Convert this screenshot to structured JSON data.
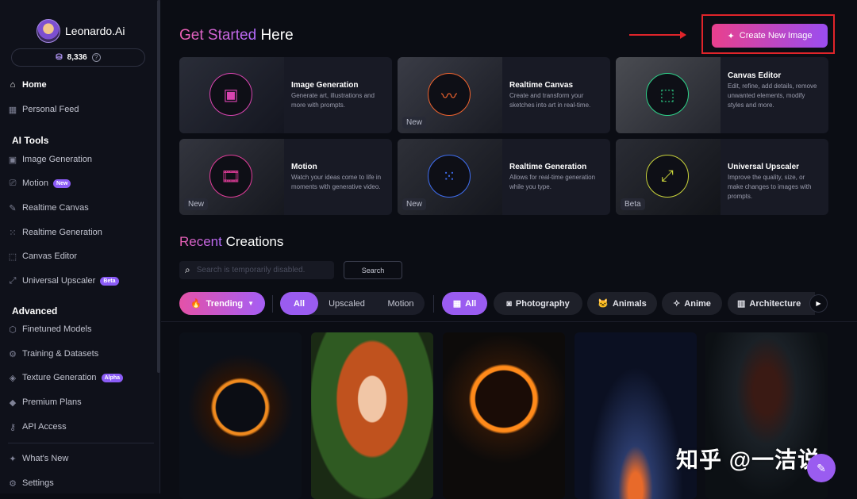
{
  "app": {
    "name": "Leonardo.Ai",
    "credits": "8,336"
  },
  "sidebar": {
    "home": "Home",
    "personal_feed": "Personal Feed",
    "ai_tools_heading": "AI Tools",
    "tools": [
      {
        "label": "Image Generation",
        "badge": ""
      },
      {
        "label": "Motion",
        "badge": "New"
      },
      {
        "label": "Realtime Canvas",
        "badge": ""
      },
      {
        "label": "Realtime Generation",
        "badge": ""
      },
      {
        "label": "Canvas Editor",
        "badge": ""
      },
      {
        "label": "Universal Upscaler",
        "badge": "Beta"
      }
    ],
    "advanced_heading": "Advanced",
    "advanced": [
      {
        "label": "Finetuned Models",
        "badge": ""
      },
      {
        "label": "Training & Datasets",
        "badge": ""
      },
      {
        "label": "Texture Generation",
        "badge": "Alpha"
      },
      {
        "label": "Premium Plans",
        "badge": ""
      },
      {
        "label": "API Access",
        "badge": ""
      }
    ],
    "whats_new": "What's New",
    "settings": "Settings"
  },
  "header": {
    "title_accent": "Get Started",
    "title_rest": "Here",
    "create_button": "Create New Image"
  },
  "cards": [
    {
      "title": "Image Generation",
      "desc": "Generate art, illustrations and more with prompts.",
      "tag": "",
      "icon": "image-icon",
      "color": "#d944b0"
    },
    {
      "title": "Realtime Canvas",
      "desc": "Create and transform your sketches into art in real-time.",
      "tag": "New",
      "icon": "scribble-icon",
      "color": "#f0632e"
    },
    {
      "title": "Canvas Editor",
      "desc": "Edit, refine, add details, remove unwanted elements, modify styles and more.",
      "tag": "",
      "icon": "select-square-icon",
      "color": "#2dd48a"
    },
    {
      "title": "Motion",
      "desc": "Watch your ideas come to life in moments with generative video.",
      "tag": "New",
      "icon": "film-icon",
      "color": "#e23d9a"
    },
    {
      "title": "Realtime Generation",
      "desc": "Allows for real-time generation while you type.",
      "tag": "New",
      "icon": "grid-dots-icon",
      "color": "#3f6ef2"
    },
    {
      "title": "Universal Upscaler",
      "desc": "Improve the quality, size, or make changes to images with prompts.",
      "tag": "Beta",
      "icon": "upscale-icon",
      "color": "#c9d33a"
    }
  ],
  "recent": {
    "title_accent": "Recent",
    "title_rest": "Creations",
    "search_placeholder": "Search is temporarily disabled.",
    "search_button": "Search",
    "trending": "Trending",
    "segments": [
      "All",
      "Upscaled",
      "Motion"
    ],
    "chips": [
      "All",
      "Photography",
      "Animals",
      "Anime",
      "Architecture"
    ]
  },
  "watermark": "知乎 @一洁说"
}
